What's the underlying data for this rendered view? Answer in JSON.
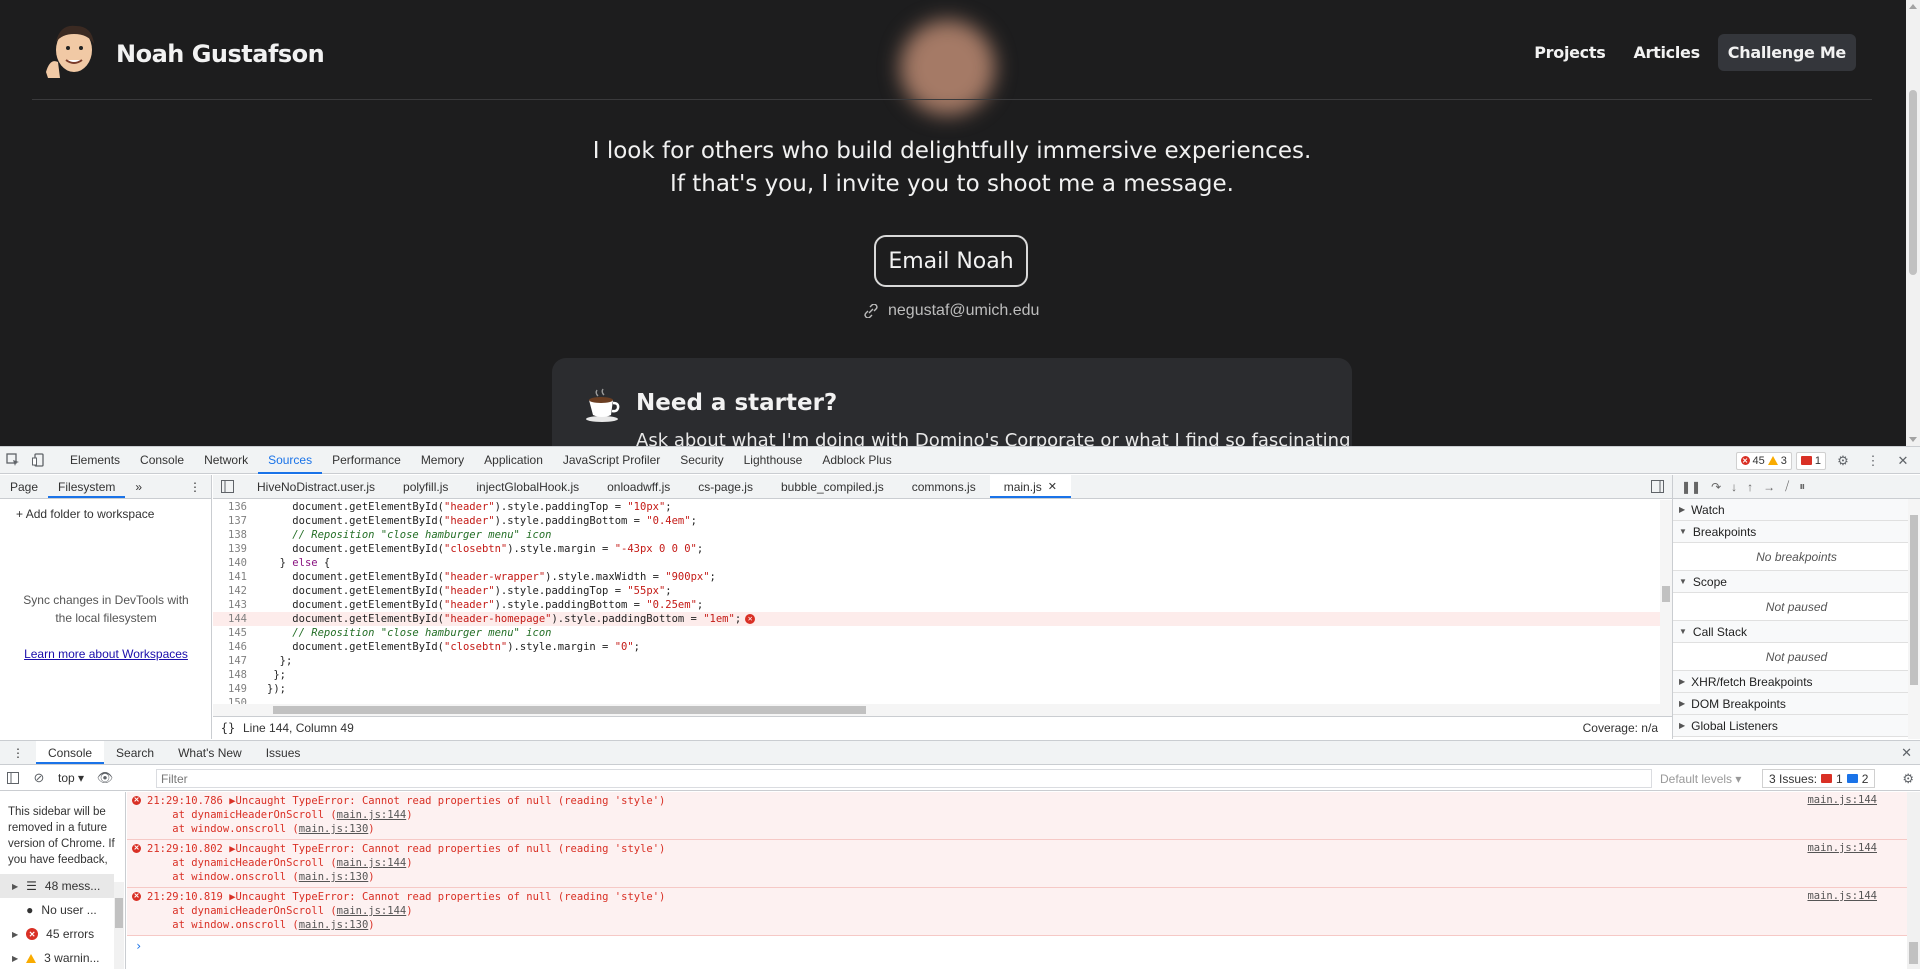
{
  "site": {
    "brand_name": "Noah Gustafson",
    "nav": [
      "Projects",
      "Articles",
      "Challenge Me"
    ],
    "tagline_1": "I look for others who build delightfully immersive experiences.",
    "tagline_2": "If that's you, I invite you to shoot me a message.",
    "email_button": "Email Noah",
    "email_address": "negustaf@umich.edu",
    "starter_title": "Need a starter?",
    "starter_text": "Ask about what I'm doing with Domino's Corporate or what I find so fascinating"
  },
  "devtools": {
    "tabs": [
      "Elements",
      "Console",
      "Network",
      "Sources",
      "Performance",
      "Memory",
      "Application",
      "JavaScript Profiler",
      "Security",
      "Lighthouse",
      "Adblock Plus"
    ],
    "active_tab": "Sources",
    "error_count": "45",
    "warning_count": "3",
    "issue_count": "1",
    "nav_tabs": [
      "Page",
      "Filesystem"
    ],
    "add_folder": "Add folder to workspace",
    "sync_text": "Sync changes in DevTools with the local filesystem",
    "learn_more": "Learn more about Workspaces",
    "file_tabs": [
      "HiveNoDistract.user.js",
      "polyfill.js",
      "injectGlobalHook.js",
      "onloadwff.js",
      "cs-page.js",
      "bubble_compiled.js",
      "commons.js",
      "main.js"
    ],
    "active_file": "main.js",
    "status_position": "Line 144, Column 49",
    "coverage": "Coverage: n/a",
    "debug_sections": {
      "watch": "Watch",
      "breakpoints": "Breakpoints",
      "no_breakpoints": "No breakpoints",
      "scope": "Scope",
      "not_paused_1": "Not paused",
      "call_stack": "Call Stack",
      "not_paused_2": "Not paused",
      "xhr": "XHR/fetch Breakpoints",
      "dom": "DOM Breakpoints",
      "global": "Global Listeners"
    },
    "drawer_tabs": [
      "Console",
      "Search",
      "What's New",
      "Issues"
    ],
    "context": "top",
    "filter_placeholder": "Filter",
    "default_levels": "Default levels",
    "issues_label": "3 Issues:",
    "issues_red": "1",
    "issues_blue": "2",
    "sidebar_note": "This sidebar will be removed in a future version of Chrome. If you have feedback, please let",
    "sidebar_items": [
      "48 mess...",
      "No user ...",
      "45 errors",
      "3 warnin..."
    ],
    "messages": [
      {
        "time": "21:29:10.786",
        "text": "Uncaught TypeError: Cannot read properties of null (reading 'style')",
        "at1": "at dynamicHeaderOnScroll (",
        "at1_link": "main.js:144",
        "at2": "at window.onscroll (",
        "at2_link": "main.js:130",
        "src": "main.js:144"
      },
      {
        "time": "21:29:10.802",
        "text": "Uncaught TypeError: Cannot read properties of null (reading 'style')",
        "at1": "at dynamicHeaderOnScroll (",
        "at1_link": "main.js:144",
        "at2": "at window.onscroll (",
        "at2_link": "main.js:130",
        "src": "main.js:144"
      },
      {
        "time": "21:29:10.819",
        "text": "Uncaught TypeError: Cannot read properties of null (reading 'style')",
        "at1": "at dynamicHeaderOnScroll (",
        "at1_link": "main.js:144",
        "at2": "at window.onscroll (",
        "at2_link": "main.js:130",
        "src": "main.js:144"
      }
    ]
  },
  "code": {
    "lines": [
      {
        "n": "136",
        "parts": [
          [
            "",
            "    document.getElementById("
          ],
          [
            "str",
            "\"header\""
          ],
          [
            "",
            ").style.paddingTop = "
          ],
          [
            "str",
            "\"10px\""
          ],
          [
            "",
            ";"
          ]
        ]
      },
      {
        "n": "137",
        "parts": [
          [
            "",
            "    document.getElementById("
          ],
          [
            "str",
            "\"header\""
          ],
          [
            "",
            ").style.paddingBottom = "
          ],
          [
            "str",
            "\"0.4em\""
          ],
          [
            "",
            ";"
          ]
        ]
      },
      {
        "n": "138",
        "parts": [
          [
            "cm",
            "    // Reposition \"close hamburger menu\" icon"
          ]
        ]
      },
      {
        "n": "139",
        "parts": [
          [
            "",
            "    document.getElementById("
          ],
          [
            "str",
            "\"closebtn\""
          ],
          [
            "",
            ").style.margin = "
          ],
          [
            "str",
            "\"-43px 0 0 0\""
          ],
          [
            "",
            ";"
          ]
        ]
      },
      {
        "n": "140",
        "parts": [
          [
            "",
            "  } "
          ],
          [
            "kw",
            "else"
          ],
          [
            "",
            " {"
          ]
        ]
      },
      {
        "n": "141",
        "parts": [
          [
            "",
            "    document.getElementById("
          ],
          [
            "str",
            "\"header-wrapper\""
          ],
          [
            "",
            ").style.maxWidth = "
          ],
          [
            "str",
            "\"900px\""
          ],
          [
            "",
            ";"
          ]
        ]
      },
      {
        "n": "142",
        "parts": [
          [
            "",
            "    document.getElementById("
          ],
          [
            "str",
            "\"header\""
          ],
          [
            "",
            ").style.paddingTop = "
          ],
          [
            "str",
            "\"55px\""
          ],
          [
            "",
            ";"
          ]
        ]
      },
      {
        "n": "143",
        "parts": [
          [
            "",
            "    document.getElementById("
          ],
          [
            "str",
            "\"header\""
          ],
          [
            "",
            ").style.paddingBottom = "
          ],
          [
            "str",
            "\"0.25em\""
          ],
          [
            "",
            ";"
          ]
        ]
      },
      {
        "n": "144",
        "err": true,
        "parts": [
          [
            "",
            "    document.getElementById("
          ],
          [
            "str",
            "\"header-homepage\""
          ],
          [
            "",
            ").style.paddingBottom = "
          ],
          [
            "str",
            "\"1em\""
          ],
          [
            "",
            ";"
          ]
        ]
      },
      {
        "n": "145",
        "parts": [
          [
            "cm",
            "    // Reposition \"close hamburger menu\" icon"
          ]
        ]
      },
      {
        "n": "146",
        "parts": [
          [
            "",
            "    document.getElementById("
          ],
          [
            "str",
            "\"closebtn\""
          ],
          [
            "",
            ").style.margin = "
          ],
          [
            "str",
            "\"0\""
          ],
          [
            "",
            ";"
          ]
        ]
      },
      {
        "n": "147",
        "parts": [
          [
            "",
            "  };"
          ]
        ]
      },
      {
        "n": "148",
        "parts": [
          [
            "",
            " };"
          ]
        ]
      },
      {
        "n": "149",
        "parts": [
          [
            "",
            "});"
          ]
        ]
      },
      {
        "n": "150",
        "parts": [
          [
            "",
            ""
          ]
        ]
      }
    ]
  }
}
